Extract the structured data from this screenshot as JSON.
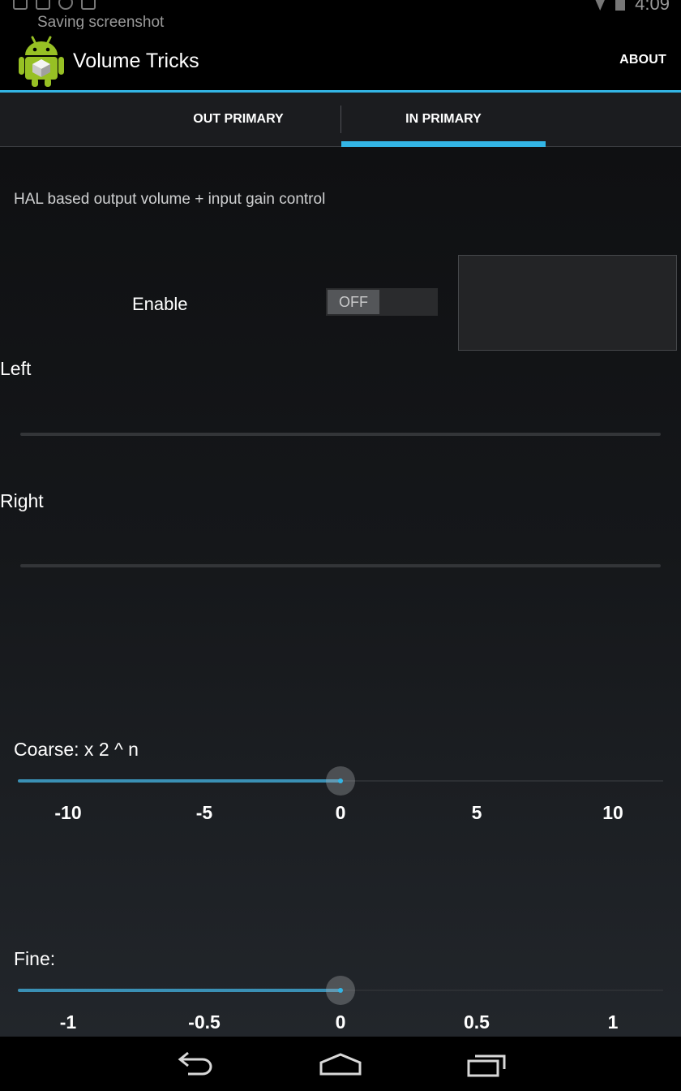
{
  "status_bar": {
    "notification_text": "Saving screenshot",
    "time": "4:09",
    "icons": [
      "screenshot-icon",
      "notification-icon",
      "notification-icon",
      "mail-icon",
      "wifi-icon",
      "battery-icon"
    ]
  },
  "action_bar": {
    "app_title": "Volume Tricks",
    "about_label": "ABOUT",
    "app_icon": "android-robot-icon"
  },
  "tabs": [
    {
      "label": "OUT PRIMARY",
      "selected": false
    },
    {
      "label": "IN PRIMARY",
      "selected": true
    }
  ],
  "main": {
    "description": "HAL based output volume + input gain control",
    "enable_label": "Enable",
    "toggle_state": "OFF",
    "left_label": "Left",
    "right_label": "Right"
  },
  "coarse": {
    "label": "Coarse: x 2 ^ n",
    "value": 0,
    "min": -12,
    "max": 12,
    "ticks": [
      "-10",
      "-5",
      "0",
      "5",
      "10"
    ]
  },
  "fine": {
    "label": "Fine:",
    "value": 0,
    "min": -1.2,
    "max": 1.2,
    "ticks": [
      "-1",
      "-0.5",
      "0",
      "0.5",
      "1"
    ]
  },
  "colors": {
    "accent": "#33b5e5",
    "slider_fill": "#3a90b5",
    "background_top": "#0f1012",
    "background_bottom": "#22262b"
  },
  "nav_bar": {
    "icons": [
      "back-icon",
      "home-icon",
      "recent-apps-icon"
    ]
  }
}
